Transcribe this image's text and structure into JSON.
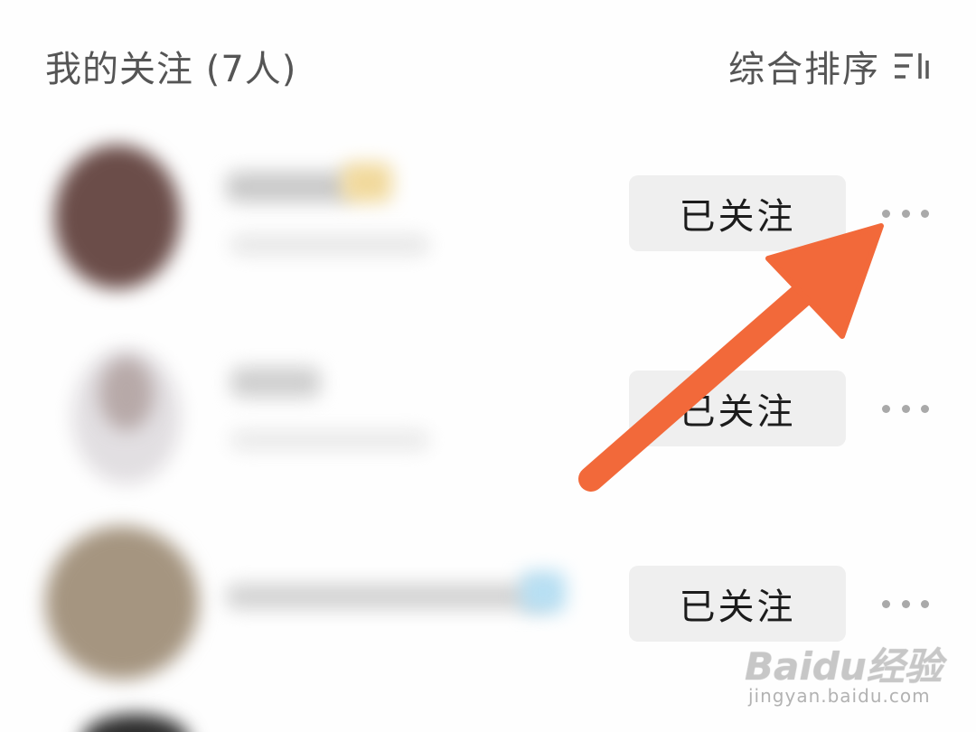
{
  "header": {
    "title": "我的关注 (7人)",
    "sort_label": "综合排序",
    "sort_icon": "sort-icon"
  },
  "following_list": [
    {
      "button_label": "已关注",
      "more_icon": "more-dots-icon"
    },
    {
      "button_label": "已关注",
      "more_icon": "more-dots-icon"
    },
    {
      "button_label": "已关注",
      "more_icon": "more-dots-icon"
    }
  ],
  "annotation": {
    "arrow_color": "#F2693A",
    "points_to": "more-button"
  },
  "watermark": {
    "brand": "Baidu经验",
    "url": "jingyan.baidu.com"
  }
}
